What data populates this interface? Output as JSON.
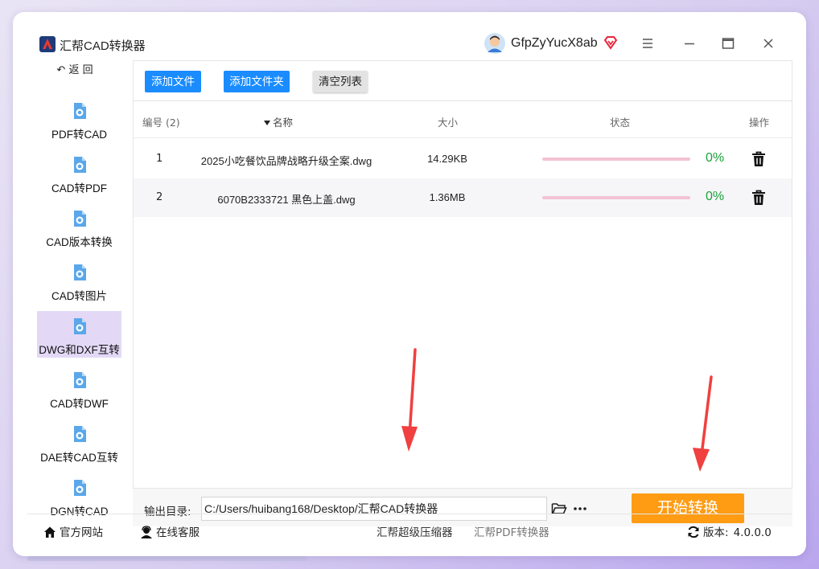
{
  "app": {
    "title": "汇帮CAD转换器"
  },
  "user": {
    "name": "GfpZyYucX8ab"
  },
  "colors": {
    "accent_blue": "#1a8cff",
    "start_orange": "#ff9c14",
    "active_sidebar": "#e3d9f7",
    "progress_track": "#f3c3d4",
    "percent_green": "#1aa33a"
  },
  "sidebar": {
    "back_label": "返 回",
    "items": [
      {
        "label": "PDF转CAD",
        "icon": "pdf-to-cad-icon",
        "active": false
      },
      {
        "label": "CAD转PDF",
        "icon": "cad-to-pdf-icon",
        "active": false
      },
      {
        "label": "CAD版本转换",
        "icon": "cad-version-icon",
        "active": false
      },
      {
        "label": "CAD转图片",
        "icon": "cad-to-image-icon",
        "active": false
      },
      {
        "label": "DWG和DXF互转",
        "icon": "dwg-dxf-icon",
        "active": true
      },
      {
        "label": "CAD转DWF",
        "icon": "cad-to-dwf-icon",
        "active": false
      },
      {
        "label": "DAE转CAD互转",
        "icon": "dae-to-cad-icon",
        "active": false
      },
      {
        "label": "DGN转CAD",
        "icon": "dgn-to-cad-icon",
        "active": false
      }
    ]
  },
  "toolbar": {
    "add_file": "添加文件",
    "add_folder": "添加文件夹",
    "clear_list": "清空列表"
  },
  "table": {
    "headers": {
      "index": "编号 (2)",
      "name": "名称",
      "size": "大小",
      "status": "状态",
      "action": "操作"
    },
    "rows": [
      {
        "index": "1",
        "name": "2025小吃餐饮品牌战略升级全案.dwg",
        "size": "14.29KB",
        "progress": 0,
        "percent": "0%"
      },
      {
        "index": "2",
        "name": "6070B2333721 黑色上盖.dwg",
        "size": "1.36MB",
        "progress": 0,
        "percent": "0%"
      }
    ]
  },
  "output": {
    "label": "输出目录:",
    "path": "C:/Users/huibang168/Desktop/汇帮CAD转换器",
    "start_label": "开始转换"
  },
  "footer": {
    "website": "官方网站",
    "support": "在线客服",
    "compressor": "汇帮超级压缩器",
    "pdf_converter": "汇帮PDF转换器",
    "version_label": "版本:",
    "version": "4.0.0.0"
  }
}
